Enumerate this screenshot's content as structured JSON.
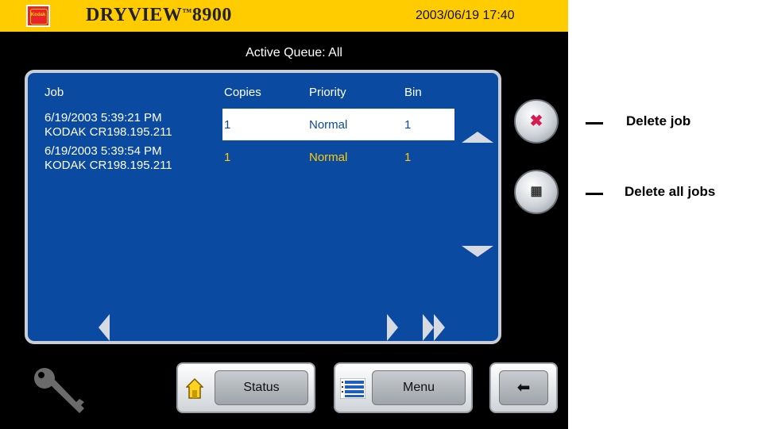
{
  "header": {
    "product_name": "DRYVIEW",
    "trademark": "™",
    "model": "8900",
    "datetime": "2003/06/19 17:40",
    "logo_text": "Kodak"
  },
  "queue": {
    "label": "Active Queue: All"
  },
  "table": {
    "columns": [
      "Job",
      "Copies",
      "Priority",
      "Bin"
    ],
    "rows": [
      {
        "job_line1": "6/19/2003 5:39:21 PM",
        "job_line2": "KODAK CR198.195.211",
        "copies": "1",
        "priority": "Normal",
        "bin": "1",
        "state": "selected"
      },
      {
        "job_line1": "6/19/2003 5:39:54 PM",
        "job_line2": "KODAK CR198.195.211",
        "copies": "1",
        "priority": "Normal",
        "bin": "1",
        "state": "normal"
      }
    ]
  },
  "buttons": {
    "status": "Status",
    "menu": "Menu",
    "delete_job_glyph": "✖",
    "delete_all_glyph": "▦",
    "back_glyph": "⬅"
  },
  "callouts": {
    "delete_job": "Delete job",
    "delete_all": "Delete all jobs"
  },
  "colors": {
    "header_bg": "#ffcc00",
    "panel_blue": "#0a4aa0",
    "selected_row_text": "#0a4aa0",
    "queued_row_text": "#ffcc00"
  },
  "icons": [
    "kodak-logo",
    "scroll-up-arrow-icon",
    "scroll-down-arrow-icon",
    "page-left-arrow-icon",
    "page-right-arrow-icon",
    "page-last-arrow-icon",
    "delete-job-icon",
    "delete-all-icon",
    "key-icon",
    "home-icon",
    "menu-list-icon",
    "back-arrow-icon"
  ]
}
